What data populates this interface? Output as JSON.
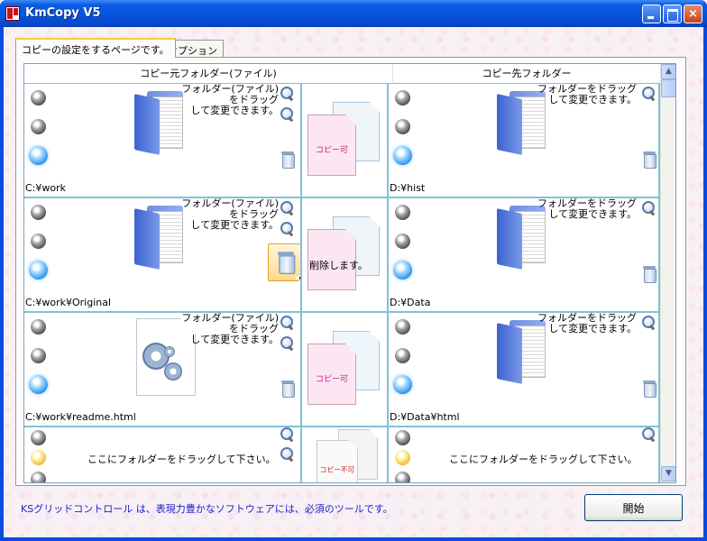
{
  "window": {
    "title": "KmCopy V5",
    "minimize": "",
    "maximize": "",
    "close": "×"
  },
  "tabs": [
    {
      "label": "コピーの設定をするページです。",
      "active": true
    },
    {
      "label": "オプション",
      "active": false
    }
  ],
  "grid": {
    "columns": {
      "source": "コピー元フォルダー(ファイル)",
      "dest": "コピー先フォルダー"
    },
    "rows": [
      {
        "src_hint": "フォルダー(ファイル)\nをドラッグ\nして変更できます。",
        "src_path": "C:¥work",
        "src_icon": "folder-icon",
        "action_label": "コピー可",
        "dst_hint": "フォルダーをドラッグ\nして変更できます。",
        "dst_path": "D:¥hist"
      },
      {
        "src_hint": "フォルダー(ファイル)\nをドラッグ\nして変更できます。",
        "src_path": "C:¥work¥Original",
        "src_icon": "folder-icon",
        "action_label": "削除します。",
        "dst_hint": "フォルダーをドラッグ\nして変更できます。",
        "dst_path": "D:¥Data"
      },
      {
        "src_hint": "フォルダー(ファイル)\nをドラッグ\nして変更できます。",
        "src_path": "C:¥work¥readme.html",
        "src_icon": "gear-document-icon",
        "action_label": "コピー可",
        "dst_hint": "フォルダーをドラッグ\nして変更できます。",
        "dst_path": "D:¥Data¥html"
      },
      {
        "src_empty": "ここにフォルダーをドラッグして下さい。",
        "action_label": "コピー不可",
        "dst_empty": "ここにフォルダーをドラッグして下さい。"
      }
    ]
  },
  "footer": {
    "message": "KSグリッドコントロール は、表現力豊かなソフトウェアには、必須のツールです。",
    "start_button": "開始"
  },
  "colors": {
    "titlebar": "#0a5ce6",
    "grid_line": "#7ec3d6",
    "footer_text": "#2020c8",
    "selection": "#ffd88c"
  }
}
